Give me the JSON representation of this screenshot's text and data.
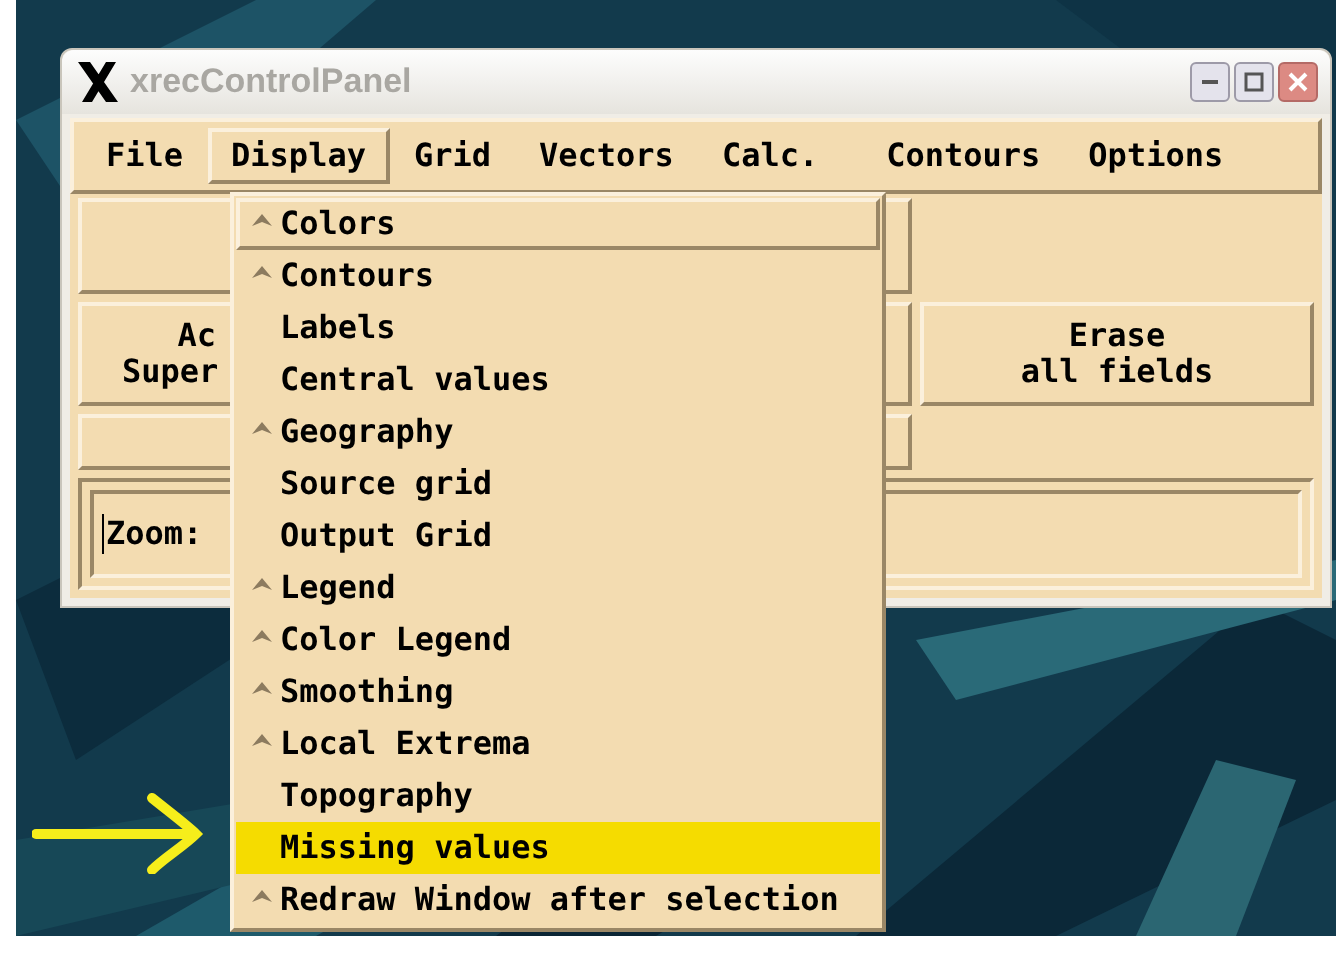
{
  "window": {
    "title": "xrecControlPanel"
  },
  "menubar": [
    {
      "label": "File",
      "selected": false
    },
    {
      "label": "Display",
      "selected": true
    },
    {
      "label": "Grid",
      "selected": false
    },
    {
      "label": "Vectors",
      "selected": false
    },
    {
      "label": "Calc.",
      "selected": false
    },
    {
      "label": "Contours",
      "selected": false
    },
    {
      "label": "Options",
      "selected": false
    }
  ],
  "panel": {
    "partial_button": {
      "lines": [
        "Ac",
        "Super"
      ]
    },
    "erase_button": {
      "lines": [
        "Erase",
        "all fields"
      ]
    },
    "zoom_field": {
      "value": "Zoom:"
    }
  },
  "menu": {
    "items": [
      {
        "label": "Colors",
        "cascade": true,
        "armed": true,
        "highlighted": false
      },
      {
        "label": "Contours",
        "cascade": true,
        "armed": false,
        "highlighted": false
      },
      {
        "label": "Labels",
        "cascade": false,
        "armed": false,
        "highlighted": false
      },
      {
        "label": "Central values",
        "cascade": false,
        "armed": false,
        "highlighted": false
      },
      {
        "label": "Geography",
        "cascade": true,
        "armed": false,
        "highlighted": false
      },
      {
        "label": "Source grid",
        "cascade": false,
        "armed": false,
        "highlighted": false
      },
      {
        "label": "Output Grid",
        "cascade": false,
        "armed": false,
        "highlighted": false
      },
      {
        "label": "Legend",
        "cascade": true,
        "armed": false,
        "highlighted": false
      },
      {
        "label": "Color Legend",
        "cascade": true,
        "armed": false,
        "highlighted": false
      },
      {
        "label": "Smoothing",
        "cascade": true,
        "armed": false,
        "highlighted": false
      },
      {
        "label": "Local Extrema",
        "cascade": true,
        "armed": false,
        "highlighted": false
      },
      {
        "label": "Topography",
        "cascade": false,
        "armed": false,
        "highlighted": false
      },
      {
        "label": "Missing values",
        "cascade": false,
        "armed": false,
        "highlighted": true
      },
      {
        "label": "Redraw Window after selection",
        "cascade": true,
        "armed": false,
        "highlighted": false
      }
    ]
  }
}
